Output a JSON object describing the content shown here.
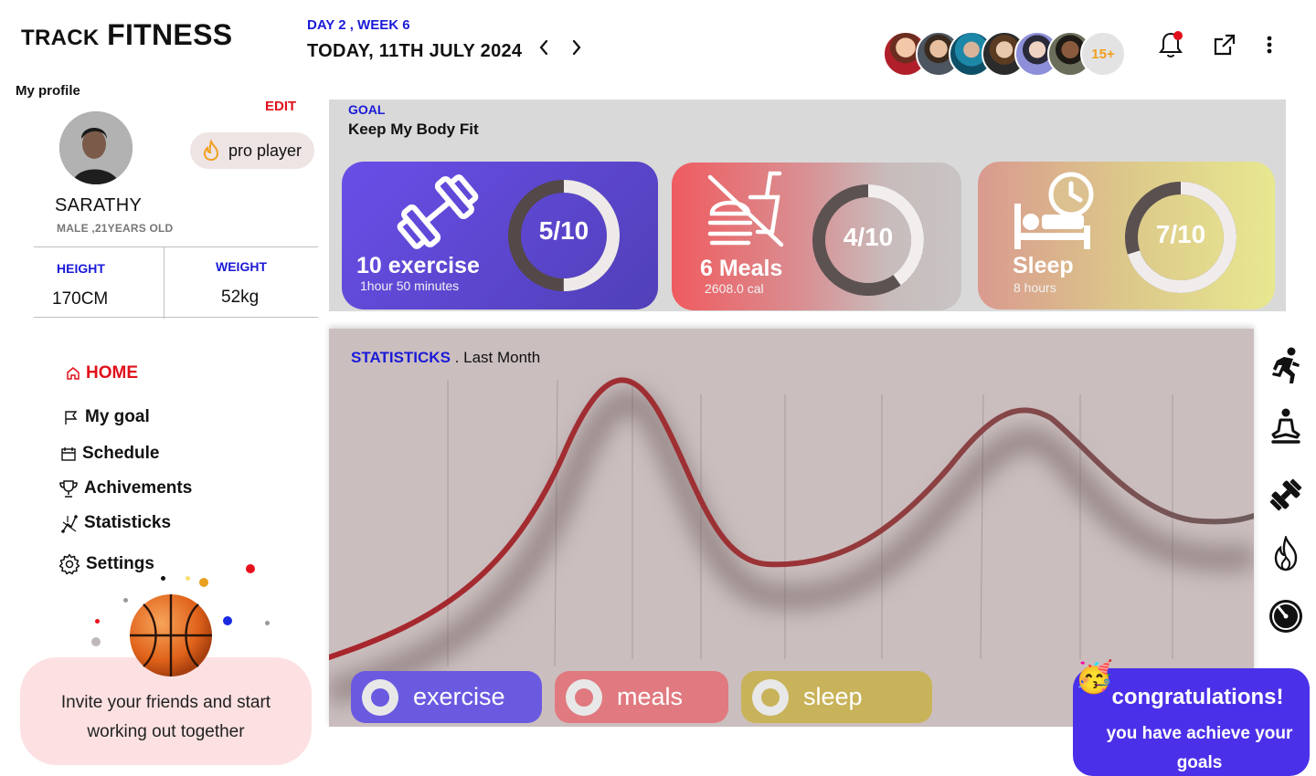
{
  "brand": {
    "prefix": "TRACK",
    "name": "FITNESS"
  },
  "header": {
    "day_week": "DAY 2 , WEEK 6",
    "date": "TODAY, 11TH JULY 2024",
    "friends_more": "15+",
    "prev_icon": "chevron-left-icon",
    "next_icon": "chevron-right-icon",
    "notification_icon": "bell-icon",
    "share_icon": "external-link-icon",
    "menu_icon": "more-vertical-icon"
  },
  "profile": {
    "section_label": "My profile",
    "edit_label": "EDIT",
    "badge": "pro player",
    "name": "SARATHY",
    "details": "MALE ,21YEARS OLD",
    "height_label": "HEIGHT",
    "height_value": "170CM",
    "weight_label": "WEIGHT",
    "weight_value": "52kg"
  },
  "nav": {
    "items": [
      {
        "label": "HOME",
        "icon": "home-icon"
      },
      {
        "label": "My goal",
        "icon": "flag-icon"
      },
      {
        "label": "Schedule",
        "icon": "calendar-icon"
      },
      {
        "label": "Achivements",
        "icon": "trophy-icon"
      },
      {
        "label": "Statisticks",
        "icon": "chart-icon"
      },
      {
        "label": "Settings",
        "icon": "gear-icon"
      }
    ]
  },
  "invite": {
    "text": "Invite your friends and start working out together"
  },
  "goal": {
    "label": "GOAL",
    "title": "Keep My Body Fit",
    "cards": [
      {
        "title": "10 exercise",
        "subtitle": "1hour 50 minutes",
        "progress": "5/10",
        "fraction": 0.5,
        "icon": "dumbbell-icon"
      },
      {
        "title": "6 Meals",
        "subtitle": "2608.0 cal",
        "progress": "4/10",
        "fraction": 0.4,
        "icon": "no-burger-icon"
      },
      {
        "title": "Sleep",
        "subtitle": "8 hours",
        "progress": "7/10",
        "fraction": 0.7,
        "icon": "bed-clock-icon"
      }
    ]
  },
  "stats": {
    "title_key": "STATISTICKS",
    "title_rest": ". Last Month",
    "legend": [
      {
        "label": "exercise",
        "color": "#6a5ae0"
      },
      {
        "label": "meals",
        "color": "#e07a80"
      },
      {
        "label": "sleep",
        "color": "#c8b35a"
      }
    ]
  },
  "side_icons": [
    "running-icon",
    "meditation-icon",
    "dumbbell-icon",
    "flame-icon",
    "timer-icon"
  ],
  "congrats": {
    "title": "congratulations!",
    "message": "you have achieve your goals",
    "emoji": "🥳"
  },
  "colors": {
    "accent_blue": "#1a1ad8",
    "accent_red": "#e0101c",
    "exercise_card": "#5b44dd",
    "meals_card": "#ef5b5f",
    "sleep_card": "#e5e68f"
  }
}
